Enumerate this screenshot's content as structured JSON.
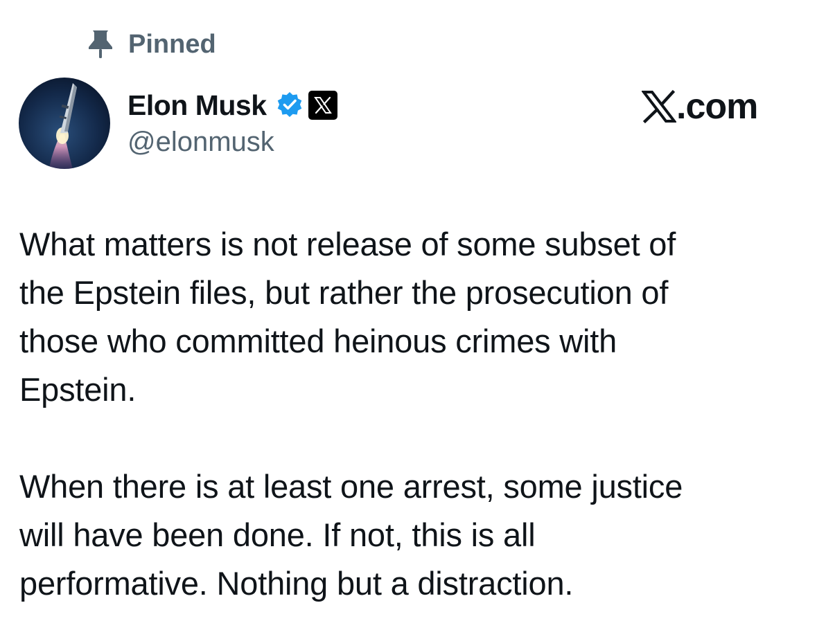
{
  "pinned": {
    "label": "Pinned",
    "icon": "pin-icon"
  },
  "author": {
    "display_name": "Elon Musk",
    "handle": "@elonmusk",
    "avatar_icon": "rocket-avatar",
    "verified_icon": "verified-badge-icon",
    "affiliate_icon": "x-logo-badge-icon"
  },
  "brand": {
    "text": "X.com",
    "icon": "x-logo-icon"
  },
  "tweet": {
    "paragraphs": [
      "What matters is not release of some subset of\nthe Epstein files, but rather the prosecution of\nthose who committed heinous crimes with\nEpstein.",
      "When there is at least one arrest, some justice\nwill have been done. If not, this is all\nperformative. Nothing but a distraction."
    ]
  },
  "colors": {
    "text_primary": "#0f1419",
    "text_secondary": "#536471",
    "verified_blue": "#1d9bf0",
    "background": "#ffffff"
  }
}
